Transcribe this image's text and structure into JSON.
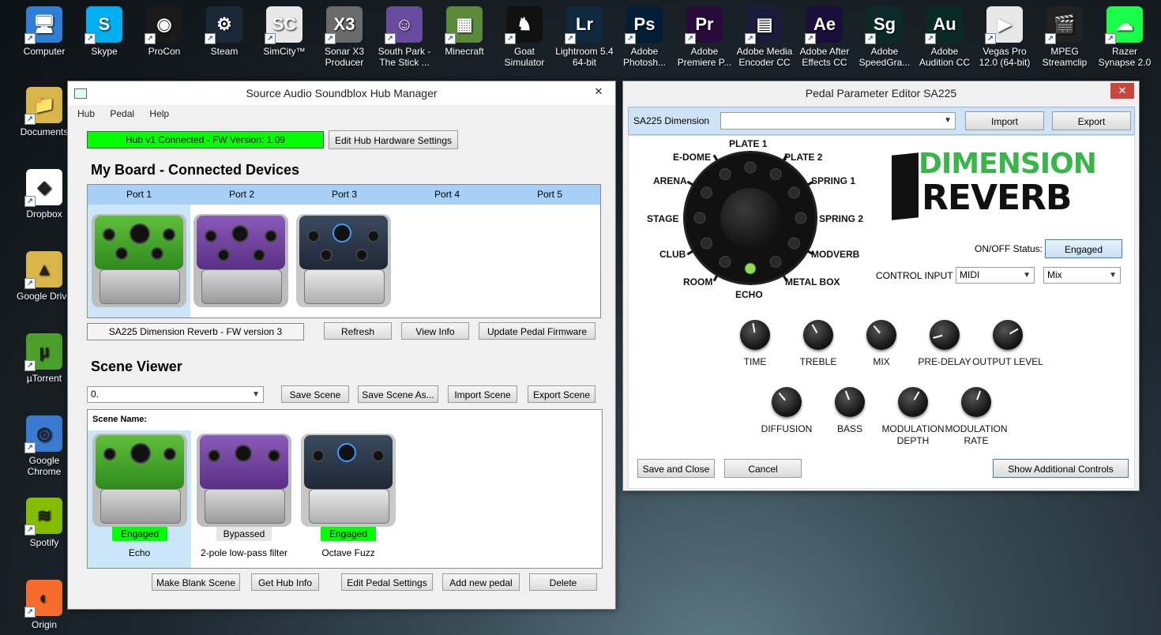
{
  "desktop": {
    "top_icons": [
      {
        "label": "Computer",
        "icon": "computer-icon",
        "color": "#2f7fd6"
      },
      {
        "label": "Skype",
        "icon": "skype-icon",
        "color": "#00aff0"
      },
      {
        "label": "ProCon",
        "icon": "procon-icon",
        "color": "#1a1a1a"
      },
      {
        "label": "Steam",
        "icon": "steam-icon",
        "color": "#1b2838"
      },
      {
        "label": "SimCity™",
        "icon": "simcity-icon",
        "color": "#e8e8e8"
      },
      {
        "label": "Sonar X3 Producer",
        "icon": "sonar-icon",
        "color": "#6b6b6b"
      },
      {
        "label": "South Park - The Stick ...",
        "icon": "southpark-icon",
        "color": "#6a4a9c"
      },
      {
        "label": "Minecraft",
        "icon": "minecraft-icon",
        "color": "#5a8a3a"
      },
      {
        "label": "Goat Simulator",
        "icon": "goat-icon",
        "color": "#111111"
      },
      {
        "label": "Lightroom 5.4 64-bit",
        "icon": "lightroom-icon",
        "color": "#0f2a3f"
      },
      {
        "label": "Adobe Photosh...",
        "icon": "photoshop-icon",
        "color": "#001e36"
      },
      {
        "label": "Adobe Premiere P...",
        "icon": "premiere-icon",
        "color": "#2a0a3a"
      },
      {
        "label": "Adobe Media Encoder CC",
        "icon": "media-encoder-icon",
        "color": "#1b1b3a"
      },
      {
        "label": "Adobe After Effects CC",
        "icon": "after-effects-icon",
        "color": "#1a0f3a"
      },
      {
        "label": "Adobe SpeedGra...",
        "icon": "speedgrade-icon",
        "color": "#0c2a2a"
      },
      {
        "label": "Adobe Audition CC",
        "icon": "audition-icon",
        "color": "#0a2a26"
      },
      {
        "label": "Vegas Pro 12.0 (64-bit)",
        "icon": "vegas-icon",
        "color": "#e8e8e8"
      },
      {
        "label": "MPEG Streamclip",
        "icon": "streamclip-icon",
        "color": "#222222"
      },
      {
        "label": "Razer Synapse 2.0",
        "icon": "razer-icon",
        "color": "#1aff4a"
      }
    ],
    "top_icon_glyphs": [
      "🖥",
      "S",
      "◉",
      "⚙",
      "SC",
      "X3",
      "☺",
      "▦",
      "♞",
      "Lr",
      "Ps",
      "Pr",
      "▤",
      "Ae",
      "Sg",
      "Au",
      "▶",
      "🎬",
      "☁"
    ],
    "left_icons": [
      {
        "label": "Documents",
        "icon": "documents-folder-icon",
        "glyph": "📁",
        "color": "#d8b64a"
      },
      {
        "label": "Dropbox",
        "icon": "dropbox-icon",
        "glyph": "◆",
        "color": "#ffffff"
      },
      {
        "label": "Google Drive",
        "icon": "google-drive-icon",
        "glyph": "▲",
        "color": "#d8b64a"
      },
      {
        "label": "µTorrent",
        "icon": "utorrent-icon",
        "glyph": "µ",
        "color": "#4aa02a"
      },
      {
        "label": "Google Chrome",
        "icon": "chrome-icon",
        "glyph": "◎",
        "color": "#3a7ad0"
      },
      {
        "label": "Spotify",
        "icon": "spotify-icon",
        "glyph": "≋",
        "color": "#84bd00"
      },
      {
        "label": "Origin",
        "icon": "origin-icon",
        "glyph": "◐",
        "color": "#f56c2d"
      }
    ]
  },
  "hub": {
    "title": "Source Audio Soundblox Hub Manager",
    "close": "✕",
    "menu": [
      "Hub",
      "Pedal",
      "Help"
    ],
    "status_text": "Hub v1 Connected - FW Version: 1.09",
    "edit_hw_button": "Edit Hub Hardware Settings",
    "board_heading": "My Board - Connected Devices",
    "ports": [
      "Port 1",
      "Port 2",
      "Port 3",
      "Port 4",
      "Port 5"
    ],
    "selected_pedal_info": "SA225 Dimension Reverb - FW version 3",
    "refresh_button": "Refresh",
    "view_info_button": "View Info",
    "update_fw_button": "Update Pedal Firmware",
    "scene_heading": "Scene Viewer",
    "scene_select": "0.",
    "save_scene": "Save Scene",
    "save_scene_as": "Save Scene As...",
    "import_scene": "Import Scene",
    "export_scene": "Export Scene",
    "scene_name_label": "Scene Name:",
    "scene_pedals": [
      {
        "status": "Engaged",
        "name": "Echo"
      },
      {
        "status": "Bypassed",
        "name": "2-pole low-pass filter"
      },
      {
        "status": "Engaged",
        "name": "Octave Fuzz"
      }
    ],
    "make_blank": "Make Blank Scene",
    "get_hub_info": "Get Hub Info",
    "edit_pedal_settings": "Edit Pedal Settings",
    "add_new_pedal": "Add new pedal",
    "delete": "Delete",
    "colors": {
      "status_green": "#00ff00",
      "port_header": "#a8cff5",
      "selected_col": "#cbe6f8"
    }
  },
  "editor": {
    "title": "Pedal Parameter Editor SA225",
    "close": "✕",
    "pedal_label": "SA225 Dimension",
    "import_button": "Import",
    "export_button": "Export",
    "dial_positions": [
      "PLATE 1",
      "PLATE 2",
      "SPRING 1",
      "SPRING 2",
      "MODVERB",
      "METAL BOX",
      "ECHO",
      "ROOM",
      "CLUB",
      "STAGE",
      "ARENA",
      "E-DOME"
    ],
    "logo_line1": "DIMENSION",
    "logo_line2": "REVERB",
    "onoff_label": "ON/OFF Status:",
    "onoff_value": "Engaged",
    "control_input_label": "CONTROL INPUT",
    "control_input_value": "MIDI",
    "control_target_value": "Mix",
    "knobs_row1": [
      {
        "label": "TIME",
        "angle": -10
      },
      {
        "label": "TREBLE",
        "angle": -30
      },
      {
        "label": "MIX",
        "angle": -40
      },
      {
        "label": "PRE-DELAY",
        "angle": -105
      },
      {
        "label": "OUTPUT LEVEL",
        "angle": 60
      }
    ],
    "knobs_row2": [
      {
        "label": "DIFFUSION",
        "angle": -40
      },
      {
        "label": "BASS",
        "angle": -20
      },
      {
        "label": "MODULATION DEPTH",
        "angle": 30
      },
      {
        "label": "MODULATION RATE",
        "angle": 20
      }
    ],
    "save_close": "Save and Close",
    "cancel": "Cancel",
    "show_additional": "Show Additional Controls",
    "colors": {
      "logo_green": "#39b54a",
      "header_blue": "#cfe3f7",
      "active_led": "#8de04a"
    }
  }
}
